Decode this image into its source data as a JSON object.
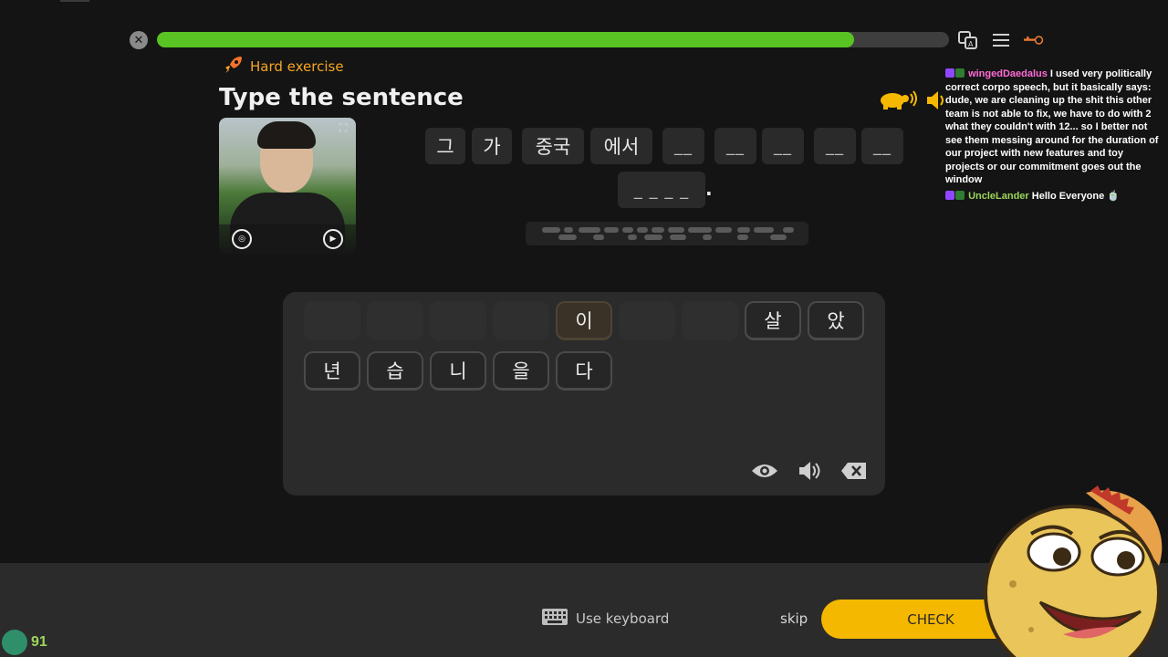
{
  "top": {
    "progress_fraction": 0.88,
    "close_icon": "close-icon",
    "icons": [
      "translate-icon",
      "menu-icon",
      "key-icon"
    ]
  },
  "exercise": {
    "badge_label": "Hard exercise",
    "title": "Type the sentence"
  },
  "sentence": {
    "tokens": [
      "그",
      "가",
      "중국",
      "에서"
    ],
    "blanks": [
      "__",
      "__",
      "__",
      "__",
      "__"
    ],
    "second_line_blank": "_ _ _ _",
    "period": "."
  },
  "bank": {
    "row1": [
      "",
      "",
      "",
      "",
      "이",
      "",
      "",
      "살",
      "았"
    ],
    "row2": [
      "년",
      "습",
      "니",
      "을",
      "다"
    ]
  },
  "chat": {
    "messages": [
      {
        "user": "wingedDaedalus",
        "text": "I used very politically correct corpo speech, but it basically says: dude, we are cleaning up the shit this other team is not able to fix, we have to do with 2 what they couldn't with 12... so I better not see them messing around for the duration of our project with new features and toy projects or our commitment goes out the window"
      },
      {
        "user": "UncleLander",
        "text": "Hello Everyone"
      }
    ]
  },
  "footer": {
    "keyboard_label": "Use keyboard",
    "skip_label": "skip",
    "check_label": "CHECK"
  },
  "streamer": {
    "count": "91"
  },
  "colors": {
    "progress": "#58c322",
    "accent": "#f5a623",
    "check": "#f5b800"
  }
}
